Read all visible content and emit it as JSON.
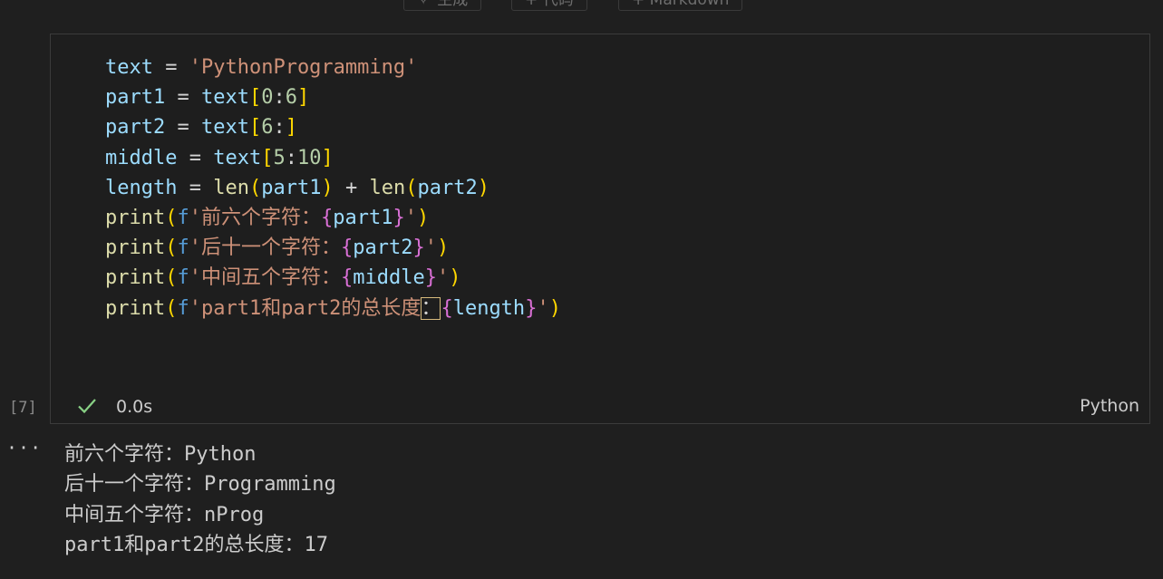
{
  "toolbar": {
    "buttons": [
      {
        "icon": "sparkle-icon",
        "label": "生成"
      },
      {
        "icon": "plus-icon",
        "label": "+ 代码"
      },
      {
        "icon": "plus-icon",
        "label": "+ Markdown"
      }
    ]
  },
  "cell": {
    "execution_count": "[7]",
    "status": "success",
    "duration": "0.0s",
    "language": "Python",
    "code_lines": [
      [
        [
          "var",
          "text"
        ],
        [
          "op",
          " = "
        ],
        [
          "str",
          "'PythonProgramming'"
        ]
      ],
      [
        [
          "var",
          "part1"
        ],
        [
          "op",
          " = "
        ],
        [
          "var",
          "text"
        ],
        [
          "br1",
          "["
        ],
        [
          "num",
          "0"
        ],
        [
          "op",
          ":"
        ],
        [
          "num",
          "6"
        ],
        [
          "br1",
          "]"
        ]
      ],
      [
        [
          "var",
          "part2"
        ],
        [
          "op",
          " = "
        ],
        [
          "var",
          "text"
        ],
        [
          "br1",
          "["
        ],
        [
          "num",
          "6"
        ],
        [
          "op",
          ":"
        ],
        [
          "br1",
          "]"
        ]
      ],
      [
        [
          "var",
          "middle"
        ],
        [
          "op",
          " = "
        ],
        [
          "var",
          "text"
        ],
        [
          "br1",
          "["
        ],
        [
          "num",
          "5"
        ],
        [
          "op",
          ":"
        ],
        [
          "num",
          "10"
        ],
        [
          "br1",
          "]"
        ]
      ],
      [
        [
          "var",
          "length"
        ],
        [
          "op",
          " = "
        ],
        [
          "fn",
          "len"
        ],
        [
          "br1",
          "("
        ],
        [
          "var",
          "part1"
        ],
        [
          "br1",
          ")"
        ],
        [
          "op",
          " + "
        ],
        [
          "fn",
          "len"
        ],
        [
          "br1",
          "("
        ],
        [
          "var",
          "part2"
        ],
        [
          "br1",
          ")"
        ]
      ],
      [
        [
          "fn",
          "print"
        ],
        [
          "br1",
          "("
        ],
        [
          "kw",
          "f"
        ],
        [
          "str",
          "'前六个字符："
        ],
        [
          "br2",
          "{"
        ],
        [
          "var",
          "part1"
        ],
        [
          "br2",
          "}"
        ],
        [
          "str",
          "'"
        ],
        [
          "br1",
          ")"
        ]
      ],
      [
        [
          "fn",
          "print"
        ],
        [
          "br1",
          "("
        ],
        [
          "kw",
          "f"
        ],
        [
          "str",
          "'后十一个字符："
        ],
        [
          "br2",
          "{"
        ],
        [
          "var",
          "part2"
        ],
        [
          "br2",
          "}"
        ],
        [
          "str",
          "'"
        ],
        [
          "br1",
          ")"
        ]
      ],
      [
        [
          "fn",
          "print"
        ],
        [
          "br1",
          "("
        ],
        [
          "kw",
          "f"
        ],
        [
          "str",
          "'中间五个字符："
        ],
        [
          "br2",
          "{"
        ],
        [
          "var",
          "middle"
        ],
        [
          "br2",
          "}"
        ],
        [
          "str",
          "'"
        ],
        [
          "br1",
          ")"
        ]
      ],
      [
        [
          "fn",
          "print"
        ],
        [
          "br1",
          "("
        ],
        [
          "kw",
          "f"
        ],
        [
          "str",
          "'part1和part2的总长度"
        ],
        [
          "cursor",
          "："
        ],
        [
          "br2",
          "{"
        ],
        [
          "var",
          "length"
        ],
        [
          "br2",
          "}"
        ],
        [
          "str",
          "'"
        ],
        [
          "br1",
          ")"
        ]
      ]
    ]
  },
  "output": {
    "menu_label": "···",
    "lines": [
      "前六个字符：Python",
      "后十一个字符：Programming",
      "中间五个字符：nProg",
      "part1和part2的总长度：17"
    ]
  },
  "colors": {
    "background": "#1f1f1f",
    "success_check": "#89d185",
    "variable": "#9cdcfe",
    "string": "#ce9178",
    "number": "#b5cea8",
    "function": "#dcdcaa",
    "keyword": "#569cd6",
    "bracket_level1": "#ffd700",
    "bracket_level2": "#da70d6"
  }
}
